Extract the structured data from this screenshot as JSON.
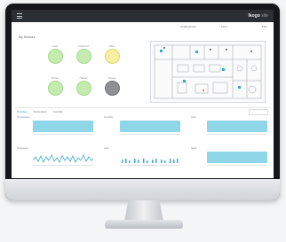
{
  "app": {
    "brand_name": "Ikogo",
    "brand_suffix": "site"
  },
  "subbar": {
    "building_select": "Headquarters",
    "floor_select": "Floor",
    "actions": "Edit"
  },
  "sensors": {
    "title": "My Sensors",
    "devices": [
      {
        "label": "Lobby",
        "value": "",
        "status": "green"
      },
      {
        "label": "Conference",
        "value": "",
        "status": "green"
      },
      {
        "label": "Office",
        "value": "",
        "status": "yellow"
      },
      {
        "label": "Kitchen",
        "value": "",
        "status": "green"
      },
      {
        "label": "Hallway",
        "value": "",
        "status": "green"
      },
      {
        "label": "Storage",
        "value": "",
        "status": "gray"
      }
    ]
  },
  "tabs": {
    "items": [
      "Overview",
      "Temperature",
      "Humidity"
    ]
  },
  "panels": [
    {
      "title": "Temperature",
      "value": "",
      "type": "band"
    },
    {
      "title": "Humidity",
      "value": "",
      "type": "band"
    },
    {
      "title": "CO2",
      "value": "",
      "type": "band"
    },
    {
      "title": "Occupancy",
      "value": "",
      "type": "spark"
    },
    {
      "title": "Light",
      "value": "",
      "type": "spark"
    },
    {
      "title": "Noise",
      "value": "",
      "type": "band"
    }
  ],
  "colors": {
    "accent": "#2b8ab0",
    "status_green": "#c5ecb0",
    "status_yellow": "#f5f0a2",
    "status_gray": "#8d9196",
    "chart_fill": "#8fd6e8"
  },
  "icons": {
    "menu": "hamburger-icon"
  }
}
